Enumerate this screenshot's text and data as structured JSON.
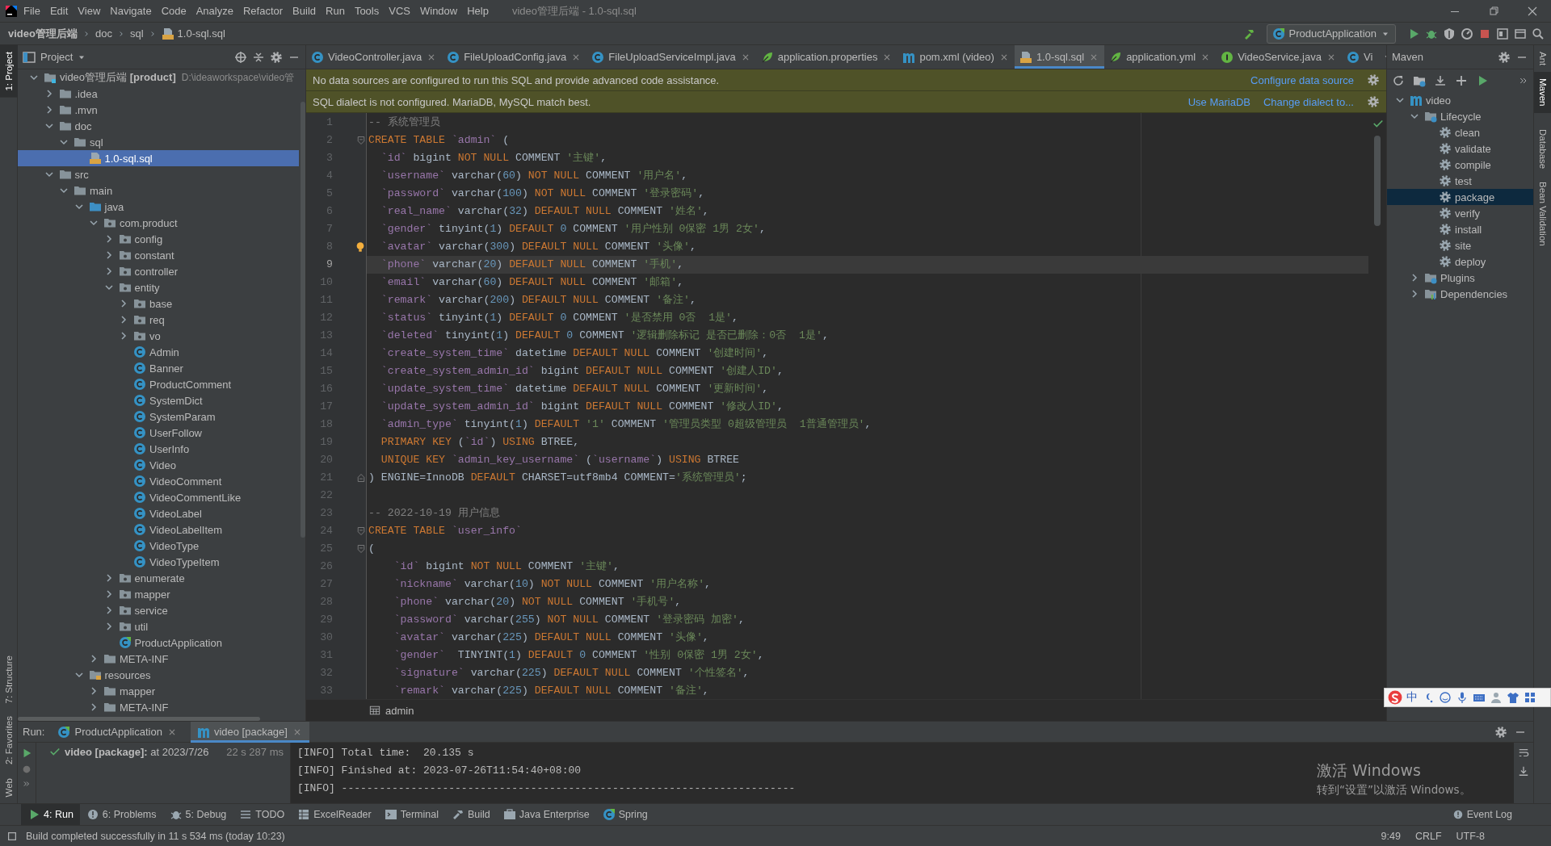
{
  "window": {
    "title": "video管理后端 - 1.0-sql.sql"
  },
  "menu": [
    "File",
    "Edit",
    "View",
    "Navigate",
    "Code",
    "Analyze",
    "Refactor",
    "Build",
    "Run",
    "Tools",
    "VCS",
    "Window",
    "Help"
  ],
  "breadcrumb": {
    "project": "video管理后端",
    "path": [
      "doc",
      "sql",
      "1.0-sql.sql"
    ]
  },
  "run_config": "ProductApplication",
  "left_strip": [
    {
      "label": "1: Project",
      "selected": true
    },
    {
      "label": "7: Structure",
      "selected": false
    },
    {
      "label": "2: Favorites",
      "selected": false
    },
    {
      "label": "Web",
      "selected": false
    }
  ],
  "right_strip": [
    {
      "label": "Ant",
      "selected": false
    },
    {
      "label": "Maven",
      "selected": true
    },
    {
      "label": "Database",
      "selected": false
    },
    {
      "label": "Bean Validation",
      "selected": false
    }
  ],
  "project_panel": {
    "title": "Project",
    "tree": [
      {
        "label": "video管理后端 **[product]**",
        "path": "D:\\ideaworkspace\\video管",
        "kind": "module",
        "expanded": true,
        "selected": false,
        "children": [
          {
            "label": ".idea",
            "kind": "folder",
            "expanded": false,
            "selected": false
          },
          {
            "label": ".mvn",
            "kind": "folder",
            "expanded": false,
            "selected": false
          },
          {
            "label": "doc",
            "kind": "folder",
            "expanded": true,
            "selected": false,
            "children": [
              {
                "label": "sql",
                "kind": "folder",
                "expanded": true,
                "selected": false,
                "children": [
                  {
                    "label": "1.0-sql.sql",
                    "kind": "sql",
                    "selected": true
                  }
                ]
              }
            ]
          },
          {
            "label": "src",
            "kind": "folder",
            "expanded": true,
            "selected": false,
            "children": [
              {
                "label": "main",
                "kind": "folder",
                "expanded": true,
                "selected": false,
                "children": [
                  {
                    "label": "java",
                    "kind": "source",
                    "expanded": true,
                    "selected": false,
                    "children": [
                      {
                        "label": "com.product",
                        "kind": "package",
                        "expanded": true,
                        "selected": false,
                        "children": [
                          {
                            "label": "config",
                            "kind": "package",
                            "expanded": false,
                            "selected": false
                          },
                          {
                            "label": "constant",
                            "kind": "package",
                            "expanded": false,
                            "selected": false
                          },
                          {
                            "label": "controller",
                            "kind": "package",
                            "expanded": false,
                            "selected": false
                          },
                          {
                            "label": "entity",
                            "kind": "package",
                            "expanded": true,
                            "selected": false,
                            "children": [
                              {
                                "label": "base",
                                "kind": "package",
                                "expanded": false,
                                "selected": false
                              },
                              {
                                "label": "req",
                                "kind": "package",
                                "expanded": false,
                                "selected": false
                              },
                              {
                                "label": "vo",
                                "kind": "package",
                                "expanded": false,
                                "selected": false
                              },
                              {
                                "label": "Admin",
                                "kind": "class",
                                "selected": false
                              },
                              {
                                "label": "Banner",
                                "kind": "class",
                                "selected": false
                              },
                              {
                                "label": "ProductComment",
                                "kind": "class",
                                "selected": false
                              },
                              {
                                "label": "SystemDict",
                                "kind": "class",
                                "selected": false
                              },
                              {
                                "label": "SystemParam",
                                "kind": "class",
                                "selected": false
                              },
                              {
                                "label": "UserFollow",
                                "kind": "class",
                                "selected": false
                              },
                              {
                                "label": "UserInfo",
                                "kind": "class",
                                "selected": false
                              },
                              {
                                "label": "Video",
                                "kind": "class",
                                "selected": false
                              },
                              {
                                "label": "VideoComment",
                                "kind": "class",
                                "selected": false
                              },
                              {
                                "label": "VideoCommentLike",
                                "kind": "class",
                                "selected": false
                              },
                              {
                                "label": "VideoLabel",
                                "kind": "class",
                                "selected": false
                              },
                              {
                                "label": "VideoLabelItem",
                                "kind": "class",
                                "selected": false
                              },
                              {
                                "label": "VideoType",
                                "kind": "class",
                                "selected": false
                              },
                              {
                                "label": "VideoTypeItem",
                                "kind": "class",
                                "selected": false
                              }
                            ]
                          },
                          {
                            "label": "enumerate",
                            "kind": "package",
                            "expanded": false,
                            "selected": false
                          },
                          {
                            "label": "mapper",
                            "kind": "package",
                            "expanded": false,
                            "selected": false
                          },
                          {
                            "label": "service",
                            "kind": "package",
                            "expanded": false,
                            "selected": false
                          },
                          {
                            "label": "util",
                            "kind": "package",
                            "expanded": false,
                            "selected": false
                          },
                          {
                            "label": "ProductApplication",
                            "kind": "spring",
                            "selected": false
                          }
                        ]
                      },
                      {
                        "label": "META-INF",
                        "kind": "folder",
                        "expanded": false,
                        "selected": false
                      }
                    ]
                  },
                  {
                    "label": "resources",
                    "kind": "resources",
                    "expanded": true,
                    "selected": false,
                    "children": [
                      {
                        "label": "mapper",
                        "kind": "folder",
                        "expanded": false,
                        "selected": false
                      },
                      {
                        "label": "META-INF",
                        "kind": "folder",
                        "expanded": false,
                        "selected": false
                      }
                    ]
                  }
                ]
              }
            ]
          }
        ]
      }
    ]
  },
  "tabs": [
    {
      "label": "VideoController.java",
      "kind": "class",
      "selected": false,
      "closable": true
    },
    {
      "label": "FileUploadConfig.java",
      "kind": "class",
      "selected": false,
      "closable": true
    },
    {
      "label": "FileUploadServiceImpl.java",
      "kind": "class",
      "selected": false,
      "closable": true
    },
    {
      "label": "application.properties",
      "kind": "config",
      "selected": false,
      "closable": true
    },
    {
      "label": "pom.xml (video)",
      "kind": "maven",
      "selected": false,
      "closable": true
    },
    {
      "label": "1.0-sql.sql",
      "kind": "sql",
      "selected": true,
      "closable": true
    },
    {
      "label": "application.yml",
      "kind": "config",
      "selected": false,
      "closable": true
    },
    {
      "label": "VideoService.java",
      "kind": "interface",
      "selected": false,
      "closable": true
    },
    {
      "label": "Vi",
      "kind": "class",
      "selected": false,
      "closable": false
    }
  ],
  "banners": [
    {
      "text": "No data sources are configured to run this SQL and provide advanced code assistance.",
      "actions": [
        "Configure data source"
      ]
    },
    {
      "text": "SQL dialect is not configured. MariaDB, MySQL match best.",
      "actions": [
        "Use MariaDB",
        "Change dialect to..."
      ]
    }
  ],
  "editor": {
    "breadcrumb": "admin",
    "lines": [
      {
        "no": "1",
        "kind": "plain",
        "current": false,
        "tokens": [
          {
            "kind": "comment",
            "text": "-- 系统管理员"
          }
        ]
      },
      {
        "no": "2",
        "kind": "fold-start",
        "current": false,
        "tokens": [
          {
            "kind": "keyword",
            "text": "CREATE TABLE "
          },
          {
            "kind": "ident",
            "text": "`admin`"
          },
          {
            "kind": "plain",
            "text": " ("
          }
        ]
      },
      {
        "no": "3",
        "kind": "plain",
        "current": false,
        "tokens": [
          {
            "kind": "ident",
            "text": "  `id`"
          },
          {
            "kind": "plain",
            "text": " bigint "
          },
          {
            "kind": "keyword",
            "text": "NOT NULL "
          },
          {
            "kind": "plain",
            "text": "COMMENT "
          },
          {
            "kind": "string",
            "text": "'主键'"
          },
          {
            "kind": "plain",
            "text": ","
          }
        ]
      },
      {
        "no": "4",
        "kind": "plain",
        "current": false,
        "tokens": [
          {
            "kind": "ident",
            "text": "  `username`"
          },
          {
            "kind": "plain",
            "text": " varchar("
          },
          {
            "kind": "number",
            "text": "60"
          },
          {
            "kind": "plain",
            "text": ") "
          },
          {
            "kind": "keyword",
            "text": "NOT NULL "
          },
          {
            "kind": "plain",
            "text": "COMMENT "
          },
          {
            "kind": "string",
            "text": "'用户名'"
          },
          {
            "kind": "plain",
            "text": ","
          }
        ]
      },
      {
        "no": "5",
        "kind": "plain",
        "current": false,
        "tokens": [
          {
            "kind": "ident",
            "text": "  `password`"
          },
          {
            "kind": "plain",
            "text": " varchar("
          },
          {
            "kind": "number",
            "text": "100"
          },
          {
            "kind": "plain",
            "text": ") "
          },
          {
            "kind": "keyword",
            "text": "NOT NULL "
          },
          {
            "kind": "plain",
            "text": "COMMENT "
          },
          {
            "kind": "string",
            "text": "'登录密码'"
          },
          {
            "kind": "plain",
            "text": ","
          }
        ]
      },
      {
        "no": "6",
        "kind": "plain",
        "current": false,
        "tokens": [
          {
            "kind": "ident",
            "text": "  `real_name`"
          },
          {
            "kind": "plain",
            "text": " varchar("
          },
          {
            "kind": "number",
            "text": "32"
          },
          {
            "kind": "plain",
            "text": ") "
          },
          {
            "kind": "keyword",
            "text": "DEFAULT NULL "
          },
          {
            "kind": "plain",
            "text": "COMMENT "
          },
          {
            "kind": "string",
            "text": "'姓名'"
          },
          {
            "kind": "plain",
            "text": ","
          }
        ]
      },
      {
        "no": "7",
        "kind": "plain",
        "current": false,
        "tokens": [
          {
            "kind": "ident",
            "text": "  `gender`"
          },
          {
            "kind": "plain",
            "text": " tinyint("
          },
          {
            "kind": "number",
            "text": "1"
          },
          {
            "kind": "plain",
            "text": ") "
          },
          {
            "kind": "keyword",
            "text": "DEFAULT "
          },
          {
            "kind": "number",
            "text": "0"
          },
          {
            "kind": "plain",
            "text": " COMMENT "
          },
          {
            "kind": "string",
            "text": "'用户性别 0保密 1男 2女'"
          },
          {
            "kind": "plain",
            "text": ","
          }
        ]
      },
      {
        "no": "8",
        "kind": "bulb",
        "current": false,
        "tokens": [
          {
            "kind": "ident",
            "text": "  `avatar`"
          },
          {
            "kind": "plain",
            "text": " varchar("
          },
          {
            "kind": "number",
            "text": "300"
          },
          {
            "kind": "plain",
            "text": ") "
          },
          {
            "kind": "keyword",
            "text": "DEFAULT NULL "
          },
          {
            "kind": "plain",
            "text": "COMMENT "
          },
          {
            "kind": "string",
            "text": "'头像'"
          },
          {
            "kind": "plain",
            "text": ","
          }
        ]
      },
      {
        "no": "9",
        "kind": "plain",
        "current": true,
        "tokens": [
          {
            "kind": "ident",
            "text": "  `phone`"
          },
          {
            "kind": "plain",
            "text": " varchar("
          },
          {
            "kind": "number",
            "text": "20"
          },
          {
            "kind": "plain",
            "text": ") "
          },
          {
            "kind": "keyword",
            "text": "DEFAULT NULL "
          },
          {
            "kind": "plain",
            "text": "COMMENT "
          },
          {
            "kind": "string",
            "text": "'手机'"
          },
          {
            "kind": "plain",
            "text": ","
          }
        ]
      },
      {
        "no": "10",
        "kind": "plain",
        "current": false,
        "tokens": [
          {
            "kind": "ident",
            "text": "  `email`"
          },
          {
            "kind": "plain",
            "text": " varchar("
          },
          {
            "kind": "number",
            "text": "60"
          },
          {
            "kind": "plain",
            "text": ") "
          },
          {
            "kind": "keyword",
            "text": "DEFAULT NULL "
          },
          {
            "kind": "plain",
            "text": "COMMENT "
          },
          {
            "kind": "string",
            "text": "'邮箱'"
          },
          {
            "kind": "plain",
            "text": ","
          }
        ]
      },
      {
        "no": "11",
        "kind": "plain",
        "current": false,
        "tokens": [
          {
            "kind": "ident",
            "text": "  `remark`"
          },
          {
            "kind": "plain",
            "text": " varchar("
          },
          {
            "kind": "number",
            "text": "200"
          },
          {
            "kind": "plain",
            "text": ") "
          },
          {
            "kind": "keyword",
            "text": "DEFAULT NULL "
          },
          {
            "kind": "plain",
            "text": "COMMENT "
          },
          {
            "kind": "string",
            "text": "'备注'"
          },
          {
            "kind": "plain",
            "text": ","
          }
        ]
      },
      {
        "no": "12",
        "kind": "plain",
        "current": false,
        "tokens": [
          {
            "kind": "ident",
            "text": "  `status`"
          },
          {
            "kind": "plain",
            "text": " tinyint("
          },
          {
            "kind": "number",
            "text": "1"
          },
          {
            "kind": "plain",
            "text": ") "
          },
          {
            "kind": "keyword",
            "text": "DEFAULT "
          },
          {
            "kind": "number",
            "text": "0"
          },
          {
            "kind": "plain",
            "text": " COMMENT "
          },
          {
            "kind": "string",
            "text": "'是否禁用 0否  1是'"
          },
          {
            "kind": "plain",
            "text": ","
          }
        ]
      },
      {
        "no": "13",
        "kind": "plain",
        "current": false,
        "tokens": [
          {
            "kind": "ident",
            "text": "  `deleted`"
          },
          {
            "kind": "plain",
            "text": " tinyint("
          },
          {
            "kind": "number",
            "text": "1"
          },
          {
            "kind": "plain",
            "text": ") "
          },
          {
            "kind": "keyword",
            "text": "DEFAULT "
          },
          {
            "kind": "number",
            "text": "0"
          },
          {
            "kind": "plain",
            "text": " COMMENT "
          },
          {
            "kind": "string",
            "text": "'逻辑删除标记 是否已删除：0否  1是'"
          },
          {
            "kind": "plain",
            "text": ","
          }
        ]
      },
      {
        "no": "14",
        "kind": "plain",
        "current": false,
        "tokens": [
          {
            "kind": "ident",
            "text": "  `create_system_time`"
          },
          {
            "kind": "plain",
            "text": " datetime "
          },
          {
            "kind": "keyword",
            "text": "DEFAULT NULL "
          },
          {
            "kind": "plain",
            "text": "COMMENT "
          },
          {
            "kind": "string",
            "text": "'创建时间'"
          },
          {
            "kind": "plain",
            "text": ","
          }
        ]
      },
      {
        "no": "15",
        "kind": "plain",
        "current": false,
        "tokens": [
          {
            "kind": "ident",
            "text": "  `create_system_admin_id`"
          },
          {
            "kind": "plain",
            "text": " bigint "
          },
          {
            "kind": "keyword",
            "text": "DEFAULT NULL "
          },
          {
            "kind": "plain",
            "text": "COMMENT "
          },
          {
            "kind": "string",
            "text": "'创建人ID'"
          },
          {
            "kind": "plain",
            "text": ","
          }
        ]
      },
      {
        "no": "16",
        "kind": "plain",
        "current": false,
        "tokens": [
          {
            "kind": "ident",
            "text": "  `update_system_time`"
          },
          {
            "kind": "plain",
            "text": " datetime "
          },
          {
            "kind": "keyword",
            "text": "DEFAULT NULL "
          },
          {
            "kind": "plain",
            "text": "COMMENT "
          },
          {
            "kind": "string",
            "text": "'更新时间'"
          },
          {
            "kind": "plain",
            "text": ","
          }
        ]
      },
      {
        "no": "17",
        "kind": "plain",
        "current": false,
        "tokens": [
          {
            "kind": "ident",
            "text": "  `update_system_admin_id`"
          },
          {
            "kind": "plain",
            "text": " bigint "
          },
          {
            "kind": "keyword",
            "text": "DEFAULT NULL "
          },
          {
            "kind": "plain",
            "text": "COMMENT "
          },
          {
            "kind": "string",
            "text": "'修改人ID'"
          },
          {
            "kind": "plain",
            "text": ","
          }
        ]
      },
      {
        "no": "18",
        "kind": "plain",
        "current": false,
        "tokens": [
          {
            "kind": "ident",
            "text": "  `admin_type`"
          },
          {
            "kind": "plain",
            "text": " tinyint("
          },
          {
            "kind": "number",
            "text": "1"
          },
          {
            "kind": "plain",
            "text": ") "
          },
          {
            "kind": "keyword",
            "text": "DEFAULT "
          },
          {
            "kind": "string",
            "text": "'1'"
          },
          {
            "kind": "plain",
            "text": " COMMENT "
          },
          {
            "kind": "string",
            "text": "'管理员类型 0超级管理员  1普通管理员'"
          },
          {
            "kind": "plain",
            "text": ","
          }
        ]
      },
      {
        "no": "19",
        "kind": "plain",
        "current": false,
        "tokens": [
          {
            "kind": "keyword",
            "text": "  PRIMARY KEY "
          },
          {
            "kind": "plain",
            "text": "("
          },
          {
            "kind": "ident",
            "text": "`id`"
          },
          {
            "kind": "plain",
            "text": ") "
          },
          {
            "kind": "keyword",
            "text": "USING "
          },
          {
            "kind": "plain",
            "text": "BTREE,"
          }
        ]
      },
      {
        "no": "20",
        "kind": "plain",
        "current": false,
        "tokens": [
          {
            "kind": "keyword",
            "text": "  UNIQUE KEY "
          },
          {
            "kind": "ident",
            "text": "`admin_key_username`"
          },
          {
            "kind": "plain",
            "text": " ("
          },
          {
            "kind": "ident",
            "text": "`username`"
          },
          {
            "kind": "plain",
            "text": ") "
          },
          {
            "kind": "keyword",
            "text": "USING "
          },
          {
            "kind": "plain",
            "text": "BTREE"
          }
        ]
      },
      {
        "no": "21",
        "kind": "fold-end",
        "current": false,
        "tokens": [
          {
            "kind": "plain",
            "text": ") ENGINE=InnoDB "
          },
          {
            "kind": "keyword",
            "text": "DEFAULT "
          },
          {
            "kind": "plain",
            "text": "CHARSET=utf8mb4 COMMENT="
          },
          {
            "kind": "string",
            "text": "'系统管理员'"
          },
          {
            "kind": "plain",
            "text": ";"
          }
        ]
      },
      {
        "no": "22",
        "kind": "plain",
        "current": false
      },
      {
        "no": "23",
        "kind": "plain",
        "current": false,
        "tokens": [
          {
            "kind": "comment",
            "text": "-- 2022-10-19 用户信息"
          }
        ]
      },
      {
        "no": "24",
        "kind": "fold-start",
        "current": false,
        "tokens": [
          {
            "kind": "keyword",
            "text": "CREATE TABLE "
          },
          {
            "kind": "ident",
            "text": "`user_info`"
          }
        ]
      },
      {
        "no": "25",
        "kind": "fold-start",
        "current": false,
        "tokens": [
          {
            "kind": "plain",
            "text": "("
          }
        ]
      },
      {
        "no": "26",
        "kind": "plain",
        "current": false,
        "tokens": [
          {
            "kind": "ident",
            "text": "    `id`"
          },
          {
            "kind": "plain",
            "text": " bigint "
          },
          {
            "kind": "keyword",
            "text": "NOT NULL "
          },
          {
            "kind": "plain",
            "text": "COMMENT "
          },
          {
            "kind": "string",
            "text": "'主键'"
          },
          {
            "kind": "plain",
            "text": ","
          }
        ]
      },
      {
        "no": "27",
        "kind": "plain",
        "current": false,
        "tokens": [
          {
            "kind": "ident",
            "text": "    `nickname`"
          },
          {
            "kind": "plain",
            "text": " varchar("
          },
          {
            "kind": "number",
            "text": "10"
          },
          {
            "kind": "plain",
            "text": ") "
          },
          {
            "kind": "keyword",
            "text": "NOT NULL "
          },
          {
            "kind": "plain",
            "text": "COMMENT "
          },
          {
            "kind": "string",
            "text": "'用户名称'"
          },
          {
            "kind": "plain",
            "text": ","
          }
        ]
      },
      {
        "no": "28",
        "kind": "plain",
        "current": false,
        "tokens": [
          {
            "kind": "ident",
            "text": "    `phone`"
          },
          {
            "kind": "plain",
            "text": " varchar("
          },
          {
            "kind": "number",
            "text": "20"
          },
          {
            "kind": "plain",
            "text": ") "
          },
          {
            "kind": "keyword",
            "text": "NOT NULL "
          },
          {
            "kind": "plain",
            "text": "COMMENT "
          },
          {
            "kind": "string",
            "text": "'手机号'"
          },
          {
            "kind": "plain",
            "text": ","
          }
        ]
      },
      {
        "no": "29",
        "kind": "plain",
        "current": false,
        "tokens": [
          {
            "kind": "ident",
            "text": "    `password`"
          },
          {
            "kind": "plain",
            "text": " varchar("
          },
          {
            "kind": "number",
            "text": "255"
          },
          {
            "kind": "plain",
            "text": ") "
          },
          {
            "kind": "keyword",
            "text": "NOT NULL "
          },
          {
            "kind": "plain",
            "text": "COMMENT "
          },
          {
            "kind": "string",
            "text": "'登录密码 加密'"
          },
          {
            "kind": "plain",
            "text": ","
          }
        ]
      },
      {
        "no": "30",
        "kind": "plain",
        "current": false,
        "tokens": [
          {
            "kind": "ident",
            "text": "    `avatar`"
          },
          {
            "kind": "plain",
            "text": " varchar("
          },
          {
            "kind": "number",
            "text": "225"
          },
          {
            "kind": "plain",
            "text": ") "
          },
          {
            "kind": "keyword",
            "text": "DEFAULT NULL "
          },
          {
            "kind": "plain",
            "text": "COMMENT "
          },
          {
            "kind": "string",
            "text": "'头像'"
          },
          {
            "kind": "plain",
            "text": ","
          }
        ]
      },
      {
        "no": "31",
        "kind": "plain",
        "current": false,
        "tokens": [
          {
            "kind": "ident",
            "text": "    `gender`"
          },
          {
            "kind": "plain",
            "text": "  TINYINT("
          },
          {
            "kind": "number",
            "text": "1"
          },
          {
            "kind": "plain",
            "text": ") "
          },
          {
            "kind": "keyword",
            "text": "DEFAULT "
          },
          {
            "kind": "number",
            "text": "0"
          },
          {
            "kind": "plain",
            "text": " COMMENT "
          },
          {
            "kind": "string",
            "text": "'性别 0保密 1男 2女'"
          },
          {
            "kind": "plain",
            "text": ","
          }
        ]
      },
      {
        "no": "32",
        "kind": "plain",
        "current": false,
        "tokens": [
          {
            "kind": "ident",
            "text": "    `signature`"
          },
          {
            "kind": "plain",
            "text": " varchar("
          },
          {
            "kind": "number",
            "text": "225"
          },
          {
            "kind": "plain",
            "text": ") "
          },
          {
            "kind": "keyword",
            "text": "DEFAULT NULL "
          },
          {
            "kind": "plain",
            "text": "COMMENT "
          },
          {
            "kind": "string",
            "text": "'个性签名'"
          },
          {
            "kind": "plain",
            "text": ","
          }
        ]
      },
      {
        "no": "33",
        "kind": "plain",
        "current": false,
        "tokens": [
          {
            "kind": "ident",
            "text": "    `remark`"
          },
          {
            "kind": "plain",
            "text": " varchar("
          },
          {
            "kind": "number",
            "text": "225"
          },
          {
            "kind": "plain",
            "text": ") "
          },
          {
            "kind": "keyword",
            "text": "DEFAULT NULL "
          },
          {
            "kind": "plain",
            "text": "COMMENT "
          },
          {
            "kind": "string",
            "text": "'备注'"
          },
          {
            "kind": "plain",
            "text": ","
          }
        ]
      }
    ]
  },
  "maven": {
    "title": "Maven",
    "tree": [
      {
        "label": "video",
        "kind": "maven",
        "expanded": true,
        "selected": false,
        "children": [
          {
            "label": "Lifecycle",
            "kind": "lifecycle",
            "expanded": true,
            "selected": false,
            "children": [
              {
                "label": "clean",
                "kind": "goal",
                "selected": false
              },
              {
                "label": "validate",
                "kind": "goal",
                "selected": false
              },
              {
                "label": "compile",
                "kind": "goal",
                "selected": false
              },
              {
                "label": "test",
                "kind": "goal",
                "selected": false
              },
              {
                "label": "package",
                "kind": "goal",
                "selected": true
              },
              {
                "label": "verify",
                "kind": "goal",
                "selected": false
              },
              {
                "label": "install",
                "kind": "goal",
                "selected": false
              },
              {
                "label": "site",
                "kind": "goal",
                "selected": false
              },
              {
                "label": "deploy",
                "kind": "goal",
                "selected": false
              }
            ]
          },
          {
            "label": "Plugins",
            "kind": "lifecycle",
            "expanded": false,
            "selected": false
          },
          {
            "label": "Dependencies",
            "kind": "deps",
            "expanded": false,
            "selected": false
          }
        ]
      }
    ]
  },
  "run": {
    "label": "Run:",
    "tabs": [
      {
        "label": "ProductApplication",
        "kind": "spring",
        "selected": false
      },
      {
        "label": "video [package]",
        "kind": "maven",
        "selected": true
      }
    ],
    "task": {
      "label": "video [package]:",
      "time": "at 2023/7/26",
      "duration": "22 s 287 ms"
    },
    "console": [
      "[INFO] Total time:  20.135 s",
      "[INFO] Finished at: 2023-07-26T11:54:40+08:00",
      "[INFO] ------------------------------------------------------------------------"
    ]
  },
  "tool_tabs": [
    {
      "label": "4: Run",
      "kind": "run",
      "selected": true
    },
    {
      "label": "6: Problems",
      "kind": "problems",
      "selected": false
    },
    {
      "label": "5: Debug",
      "kind": "debug",
      "selected": false
    },
    {
      "label": "TODO",
      "kind": "todo",
      "selected": false
    },
    {
      "label": "ExcelReader",
      "kind": "excel",
      "selected": false
    },
    {
      "label": "Terminal",
      "kind": "terminal",
      "selected": false
    },
    {
      "label": "Build",
      "kind": "build",
      "selected": false
    },
    {
      "label": "Java Enterprise",
      "kind": "enterprise",
      "selected": false
    },
    {
      "label": "Spring",
      "kind": "spring",
      "selected": false
    }
  ],
  "event_log": "Event Log",
  "status_bar": {
    "message": "Build completed successfully in 11 s 534 ms (today 10:23)",
    "items": [
      "9:49",
      "CRLF",
      "UTF-8"
    ]
  },
  "ime": {
    "mode": "中"
  },
  "activation": {
    "title": "激活 Windows",
    "hint": "转到“设置”以激活 Windows。"
  }
}
